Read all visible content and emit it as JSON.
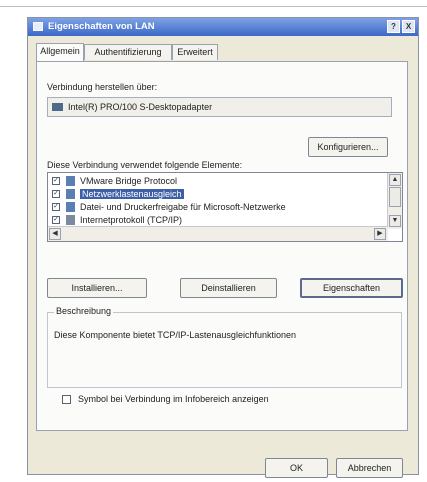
{
  "dialog": {
    "title": "Eigenschaften von LAN",
    "help_label": "?",
    "close_label": "X"
  },
  "tabs": [
    {
      "label": "Allgemein"
    },
    {
      "label": "Authentifizierung"
    },
    {
      "label": "Erweitert"
    }
  ],
  "connection": {
    "connect_using_label": "Verbindung herstellen über:",
    "adapter_name": "Intel(R) PRO/100 S-Desktopadapter",
    "configure_label": "Konfigurieren..."
  },
  "components": {
    "label": "Diese Verbindung verwendet folgende Elemente:",
    "items": [
      {
        "label": "VMware Bridge Protocol",
        "checked": true
      },
      {
        "label": "Netzwerklastenausgleich",
        "checked": true,
        "selected": true
      },
      {
        "label": "Datei- und Druckerfreigabe für Microsoft-Netzwerke",
        "checked": true
      },
      {
        "label": "Internetprotokoll (TCP/IP)",
        "checked": true
      }
    ]
  },
  "buttons": {
    "install": "Installieren...",
    "uninstall": "Deinstallieren",
    "properties": "Eigenschaften",
    "ok": "OK",
    "cancel": "Abbrechen"
  },
  "description": {
    "title": "Beschreibung",
    "text": "Diese Komponente bietet TCP/IP-Lastenausgleichfunktionen"
  },
  "show_icon": {
    "label": "Symbol bei Verbindung im Infobereich anzeigen",
    "checked": false
  },
  "colors": {
    "titlebar": "#3b68c8",
    "selection": "#3d5fa6",
    "dialog_bg": "#ece9d8"
  }
}
